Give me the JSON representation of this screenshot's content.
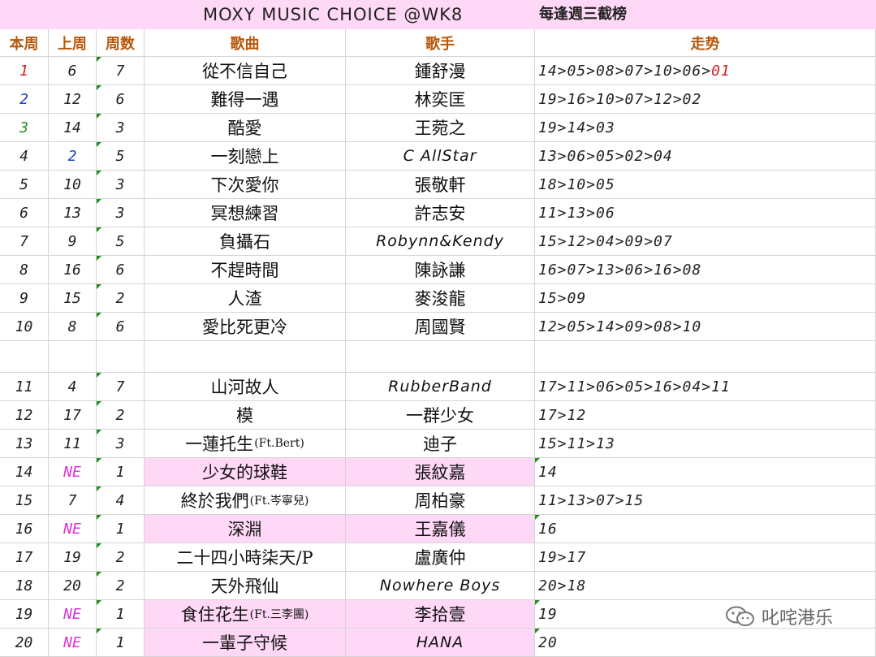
{
  "title": {
    "main": "MOXY MUSIC CHOICE @WK8",
    "note": "每逢週三截榜"
  },
  "headers": {
    "this_week": "本周",
    "last_week": "上周",
    "weeks": "周数",
    "song": "歌曲",
    "artist": "歌手",
    "trend": "走势"
  },
  "colors": {
    "pink": "#ffd8f7",
    "header_text": "#b7570a",
    "rank1": "#d61f1f",
    "rank2": "#1f3fbf",
    "rank3": "#1f8f1f",
    "new_entry": "#e02fd8",
    "last_week_up": "#1f3fbf"
  },
  "rows": [
    {
      "rank": "1",
      "last": "6",
      "weeks": "7",
      "song": "從不信自己",
      "song_ft": "",
      "artist": "鍾舒漫",
      "trend_main": "14>05>08>07>10>06>",
      "trend_end": "01"
    },
    {
      "rank": "2",
      "last": "12",
      "weeks": "6",
      "song": "難得一遇",
      "song_ft": "",
      "artist": "林奕匡",
      "trend_main": "19>16>10>07>12>02",
      "trend_end": ""
    },
    {
      "rank": "3",
      "last": "14",
      "weeks": "3",
      "song": "酷愛",
      "song_ft": "",
      "artist": "王菀之",
      "trend_main": "19>14>03",
      "trend_end": ""
    },
    {
      "rank": "4",
      "last": "2",
      "weeks": "5",
      "song": "一刻戀上",
      "song_ft": "",
      "artist": "C AllStar",
      "trend_main": "13>06>05>02>04",
      "trend_end": ""
    },
    {
      "rank": "5",
      "last": "10",
      "weeks": "3",
      "song": "下次愛你",
      "song_ft": "",
      "artist": "張敬軒",
      "trend_main": "18>10>05",
      "trend_end": ""
    },
    {
      "rank": "6",
      "last": "13",
      "weeks": "3",
      "song": "冥想練習",
      "song_ft": "",
      "artist": "許志安",
      "trend_main": "11>13>06",
      "trend_end": ""
    },
    {
      "rank": "7",
      "last": "9",
      "weeks": "5",
      "song": "負攝石",
      "song_ft": "",
      "artist": "Robynn&Kendy",
      "trend_main": "15>12>04>09>07",
      "trend_end": ""
    },
    {
      "rank": "8",
      "last": "16",
      "weeks": "6",
      "song": "不趕時間",
      "song_ft": "",
      "artist": "陳詠謙",
      "trend_main": "16>07>13>06>16>08",
      "trend_end": ""
    },
    {
      "rank": "9",
      "last": "15",
      "weeks": "2",
      "song": "人渣",
      "song_ft": "",
      "artist": "麥浚龍",
      "trend_main": "15>09",
      "trend_end": ""
    },
    {
      "rank": "10",
      "last": "8",
      "weeks": "6",
      "song": "愛比死更冷",
      "song_ft": "",
      "artist": "周國賢",
      "trend_main": "12>05>14>09>08>10",
      "trend_end": ""
    },
    {
      "rank": "11",
      "last": "4",
      "weeks": "7",
      "song": "山河故人",
      "song_ft": "",
      "artist": "RubberBand",
      "trend_main": "17>11>06>05>16>04>11",
      "trend_end": ""
    },
    {
      "rank": "12",
      "last": "17",
      "weeks": "2",
      "song": "模",
      "song_ft": "",
      "artist": "一群少女",
      "trend_main": "17>12",
      "trend_end": ""
    },
    {
      "rank": "13",
      "last": "11",
      "weeks": "3",
      "song": "一蓮托生",
      "song_ft": "(Ft.Bert)",
      "artist": "迪子",
      "trend_main": "15>11>13",
      "trend_end": ""
    },
    {
      "rank": "14",
      "last": "NE",
      "weeks": "1",
      "song": "少女的球鞋",
      "song_ft": "",
      "artist": "張紋嘉",
      "trend_main": "14",
      "trend_end": ""
    },
    {
      "rank": "15",
      "last": "7",
      "weeks": "4",
      "song": "終於我們",
      "song_ft": "(Ft.岑寧兒)",
      "artist": "周柏豪",
      "trend_main": "11>13>07>15",
      "trend_end": ""
    },
    {
      "rank": "16",
      "last": "NE",
      "weeks": "1",
      "song": "深淵",
      "song_ft": "",
      "artist": "王嘉儀",
      "trend_main": "16",
      "trend_end": ""
    },
    {
      "rank": "17",
      "last": "19",
      "weeks": "2",
      "song": "二十四小時柒天/P",
      "song_ft": "",
      "artist": "盧廣仲",
      "trend_main": "19>17",
      "trend_end": ""
    },
    {
      "rank": "18",
      "last": "20",
      "weeks": "2",
      "song": "天外飛仙",
      "song_ft": "",
      "artist": "Nowhere Boys",
      "trend_main": "20>18",
      "trend_end": ""
    },
    {
      "rank": "19",
      "last": "NE",
      "weeks": "1",
      "song": "食住花生",
      "song_ft": "(Ft.三李團)",
      "artist": "李拾壹",
      "trend_main": "19",
      "trend_end": ""
    },
    {
      "rank": "20",
      "last": "NE",
      "weeks": "1",
      "song": "一輩子守候",
      "song_ft": "",
      "artist": "HANA",
      "trend_main": "20",
      "trend_end": ""
    }
  ],
  "watermark": {
    "icon": "wechat-icon",
    "text": "叱咤港乐"
  }
}
